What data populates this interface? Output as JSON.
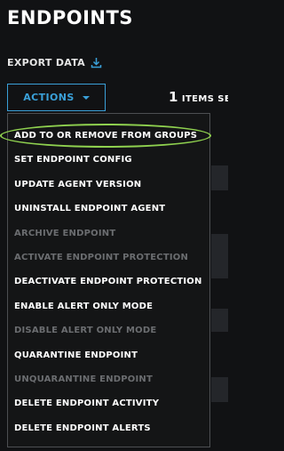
{
  "header": {
    "title": "ENDPOINTS"
  },
  "toolbar": {
    "export_label": "EXPORT DATA",
    "export_icon": "download-icon",
    "actions_label": "ACTIONS",
    "actions_icon": "caret-down-icon",
    "selected_count": "1",
    "selected_text": "ITEMS SE"
  },
  "actions_menu": {
    "items": [
      {
        "label": "ADD TO OR REMOVE FROM GROUPS",
        "enabled": true
      },
      {
        "label": "SET ENDPOINT CONFIG",
        "enabled": true
      },
      {
        "label": "UPDATE AGENT VERSION",
        "enabled": true
      },
      {
        "label": "UNINSTALL ENDPOINT AGENT",
        "enabled": true
      },
      {
        "label": "ARCHIVE ENDPOINT",
        "enabled": false
      },
      {
        "label": "ACTIVATE ENDPOINT PROTECTION",
        "enabled": false
      },
      {
        "label": "DEACTIVATE ENDPOINT PROTECTION",
        "enabled": true
      },
      {
        "label": "ENABLE ALERT ONLY MODE",
        "enabled": true
      },
      {
        "label": "DISABLE ALERT ONLY MODE",
        "enabled": false
      },
      {
        "label": "QUARANTINE ENDPOINT",
        "enabled": true
      },
      {
        "label": "UNQUARANTINE ENDPOINT",
        "enabled": false
      },
      {
        "label": "DELETE ENDPOINT ACTIVITY",
        "enabled": true
      },
      {
        "label": "DELETE ENDPOINT ALERTS",
        "enabled": true
      }
    ]
  },
  "colors": {
    "background": "#111214",
    "accent": "#3aa0d8",
    "disabled_text": "#6b6d70",
    "highlight": "#8fd14f"
  }
}
